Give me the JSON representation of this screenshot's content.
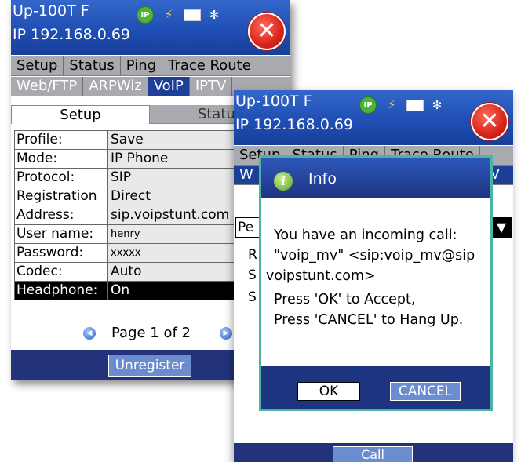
{
  "screen1": {
    "device_name": "Up-100T F",
    "ip_line": "IP 192.168.0.69",
    "status_icons": [
      "ip-icon",
      "plug-icon",
      "battery-icon",
      "bluetooth-icon"
    ],
    "close_glyph": "✕",
    "tabs_row1": [
      "Setup",
      "Status",
      "Ping",
      "Trace Route"
    ],
    "tabs_row2": [
      "Web/FTP",
      "ARPWiz",
      "VoIP",
      "IPTV"
    ],
    "active_tab": "VoIP",
    "subtabs": [
      "Setup",
      "Status"
    ],
    "settings": [
      {
        "label": "Profile:",
        "value": "Save"
      },
      {
        "label": "Mode:",
        "value": "IP Phone"
      },
      {
        "label": "Protocol:",
        "value": "SIP"
      },
      {
        "label": "Registration",
        "value": "Direct"
      },
      {
        "label": "Address:",
        "value": "sip.voipstunt.com"
      },
      {
        "label": "User name:",
        "value": "henry"
      },
      {
        "label": "Password:",
        "value": "xxxxx"
      },
      {
        "label": "Codec:",
        "value": "Auto"
      },
      {
        "label": "Headphone:",
        "value": "On"
      }
    ],
    "page_text": "Page 1 of 2",
    "unregister_label": "Unregister"
  },
  "screen2": {
    "device_name": "Up-100T F",
    "ip_line": "IP 192.168.0.69",
    "close_glyph": "✕",
    "tabs_row1": [
      "Setup",
      "Status",
      "Ping",
      "Trace Route"
    ],
    "row2_left": "W",
    "row2_right": "V",
    "pe_cell": "Pe",
    "side_letters": [
      "R",
      "S",
      "S"
    ],
    "call_label": "Call"
  },
  "dialog": {
    "title": "Info",
    "icon_glyph": "i",
    "lines": [
      "You have an incoming call:",
      "\"voip_mv\" <sip:voip_mv@sip",
      "voipstunt.com>",
      "Press 'OK' to Accept,",
      "Press 'CANCEL' to Hang Up."
    ],
    "ok_label": "OK",
    "cancel_label": "CANCEL"
  },
  "colors": {
    "titlebar": "#1f4fb4",
    "tab_bg": "#a9aaaf",
    "active_tab": "#1e3f98",
    "bottom_bar": "#23337b",
    "dialog_border": "#4db3a2"
  }
}
